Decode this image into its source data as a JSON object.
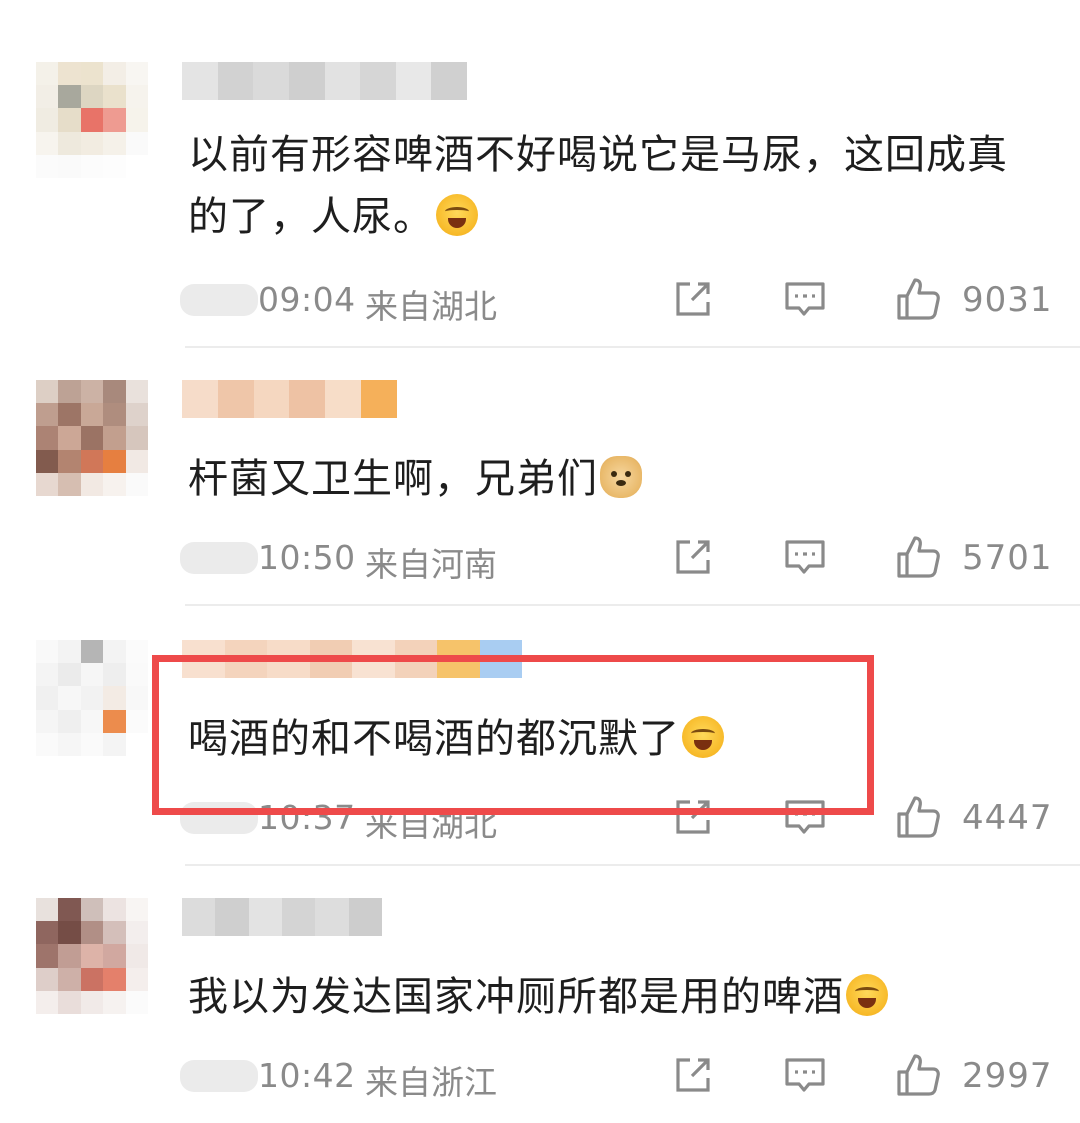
{
  "comments": [
    {
      "text": "以前有形容啤酒不好喝说它是马尿，这回成真的了，人尿。",
      "emoji": "laughing-crying-emoji",
      "time": "09:04",
      "location": "来自湖北",
      "likes": "9031"
    },
    {
      "text": "杆菌又卫生啊，兄弟们",
      "emoji": "doge-emoji",
      "time": "10:50",
      "location": "来自河南",
      "likes": "5701"
    },
    {
      "text": "喝酒的和不喝酒的都沉默了",
      "emoji": "laughing-crying-emoji",
      "time": "10:37",
      "location": "来自湖北",
      "likes": "4447"
    },
    {
      "text": "我以为发达国家冲厕所都是用的啤酒",
      "emoji": "laughing-crying-emoji",
      "time": "10:42",
      "location": "来自浙江",
      "likes": "2997"
    }
  ],
  "icons": {
    "share": "share-icon",
    "reply": "comment-icon",
    "like": "thumbs-up-icon"
  },
  "colors": {
    "highlight": "#ee4a4a",
    "meta_text": "#8a8a8a"
  }
}
